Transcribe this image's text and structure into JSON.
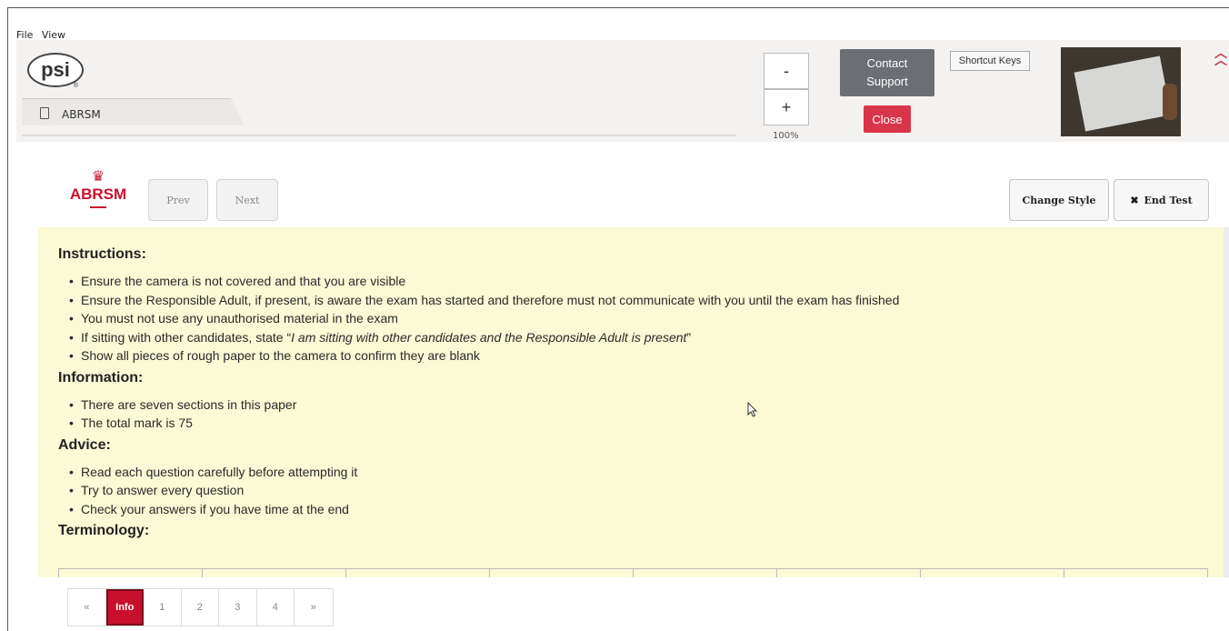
{
  "menu": {
    "items": [
      "File",
      "View"
    ]
  },
  "app": {
    "logo_text": "psi",
    "logo_mark": "®",
    "tab_label": "ABRSM"
  },
  "toolbar": {
    "zoom_out": "-",
    "zoom_in": "+",
    "zoom_level": "100%",
    "contact_line1": "Contact",
    "contact_line2": "Support",
    "close": "Close",
    "shortcut_keys": "Shortcut Keys",
    "collapse_icon": "double-chevron-up-icon"
  },
  "exam": {
    "logo_text": "ABRSM",
    "prev": "Prev",
    "next": "Next",
    "change_style": "Change Style",
    "end_test": "End Test",
    "end_test_icon": "✖"
  },
  "content": {
    "sections": [
      {
        "heading": "Instructions:",
        "items": [
          "Ensure the camera is not covered and that you are visible",
          "Ensure the Responsible Adult, if present, is aware the exam has started and therefore must not communicate with you until the exam has finished",
          "You must not use any unauthorised material in the exam",
          {
            "prefix": "If sitting with other candidates, state “",
            "emphasis": "I am sitting with other candidates and the Responsible Adult is present",
            "suffix": "”"
          },
          "Show all pieces of rough paper to the camera to confirm they are blank"
        ]
      },
      {
        "heading": "Information:",
        "items": [
          "There are seven sections in this paper",
          "The total mark is 75"
        ]
      },
      {
        "heading": "Advice:",
        "items": [
          "Read each question carefully before attempting it",
          "Try to answer every question",
          "Check your answers if you have time at the end"
        ]
      },
      {
        "heading": "Terminology:",
        "items": []
      }
    ]
  },
  "pagination": {
    "items": [
      "«",
      "Info",
      "1",
      "2",
      "3",
      "4",
      "»"
    ],
    "active": "Info"
  },
  "colors": {
    "brand_red": "#c8102e",
    "close_red": "#d9354a",
    "content_bg": "#fbf9d6",
    "contact_bg": "#6b6e73"
  }
}
